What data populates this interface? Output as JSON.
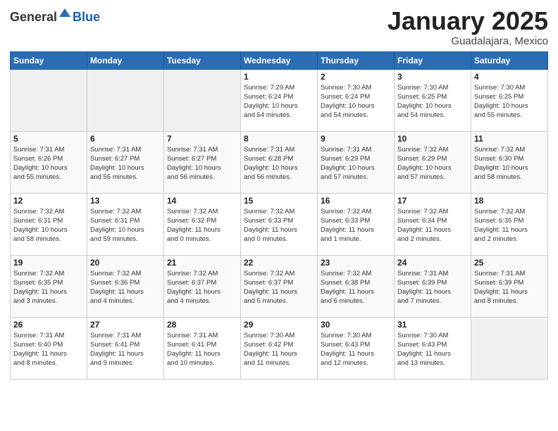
{
  "header": {
    "logo_general": "General",
    "logo_blue": "Blue",
    "month_title": "January 2025",
    "location": "Guadalajara, Mexico"
  },
  "days_of_week": [
    "Sunday",
    "Monday",
    "Tuesday",
    "Wednesday",
    "Thursday",
    "Friday",
    "Saturday"
  ],
  "weeks": [
    {
      "days": [
        {
          "num": "",
          "info": ""
        },
        {
          "num": "",
          "info": ""
        },
        {
          "num": "",
          "info": ""
        },
        {
          "num": "1",
          "info": "Sunrise: 7:29 AM\nSunset: 6:24 PM\nDaylight: 10 hours\nand 54 minutes."
        },
        {
          "num": "2",
          "info": "Sunrise: 7:30 AM\nSunset: 6:24 PM\nDaylight: 10 hours\nand 54 minutes."
        },
        {
          "num": "3",
          "info": "Sunrise: 7:30 AM\nSunset: 6:25 PM\nDaylight: 10 hours\nand 54 minutes."
        },
        {
          "num": "4",
          "info": "Sunrise: 7:30 AM\nSunset: 6:25 PM\nDaylight: 10 hours\nand 55 minutes."
        }
      ]
    },
    {
      "days": [
        {
          "num": "5",
          "info": "Sunrise: 7:31 AM\nSunset: 6:26 PM\nDaylight: 10 hours\nand 55 minutes."
        },
        {
          "num": "6",
          "info": "Sunrise: 7:31 AM\nSunset: 6:27 PM\nDaylight: 10 hours\nand 55 minutes."
        },
        {
          "num": "7",
          "info": "Sunrise: 7:31 AM\nSunset: 6:27 PM\nDaylight: 10 hours\nand 56 minutes."
        },
        {
          "num": "8",
          "info": "Sunrise: 7:31 AM\nSunset: 6:28 PM\nDaylight: 10 hours\nand 56 minutes."
        },
        {
          "num": "9",
          "info": "Sunrise: 7:31 AM\nSunset: 6:29 PM\nDaylight: 10 hours\nand 57 minutes."
        },
        {
          "num": "10",
          "info": "Sunrise: 7:32 AM\nSunset: 6:29 PM\nDaylight: 10 hours\nand 57 minutes."
        },
        {
          "num": "11",
          "info": "Sunrise: 7:32 AM\nSunset: 6:30 PM\nDaylight: 10 hours\nand 58 minutes."
        }
      ]
    },
    {
      "days": [
        {
          "num": "12",
          "info": "Sunrise: 7:32 AM\nSunset: 6:31 PM\nDaylight: 10 hours\nand 58 minutes."
        },
        {
          "num": "13",
          "info": "Sunrise: 7:32 AM\nSunset: 6:31 PM\nDaylight: 10 hours\nand 59 minutes."
        },
        {
          "num": "14",
          "info": "Sunrise: 7:32 AM\nSunset: 6:32 PM\nDaylight: 11 hours\nand 0 minutes."
        },
        {
          "num": "15",
          "info": "Sunrise: 7:32 AM\nSunset: 6:33 PM\nDaylight: 11 hours\nand 0 minutes."
        },
        {
          "num": "16",
          "info": "Sunrise: 7:32 AM\nSunset: 6:33 PM\nDaylight: 11 hours\nand 1 minute."
        },
        {
          "num": "17",
          "info": "Sunrise: 7:32 AM\nSunset: 6:34 PM\nDaylight: 11 hours\nand 2 minutes."
        },
        {
          "num": "18",
          "info": "Sunrise: 7:32 AM\nSunset: 6:35 PM\nDaylight: 11 hours\nand 2 minutes."
        }
      ]
    },
    {
      "days": [
        {
          "num": "19",
          "info": "Sunrise: 7:32 AM\nSunset: 6:35 PM\nDaylight: 11 hours\nand 3 minutes."
        },
        {
          "num": "20",
          "info": "Sunrise: 7:32 AM\nSunset: 6:36 PM\nDaylight: 11 hours\nand 4 minutes."
        },
        {
          "num": "21",
          "info": "Sunrise: 7:32 AM\nSunset: 6:37 PM\nDaylight: 11 hours\nand 4 minutes."
        },
        {
          "num": "22",
          "info": "Sunrise: 7:32 AM\nSunset: 6:37 PM\nDaylight: 11 hours\nand 5 minutes."
        },
        {
          "num": "23",
          "info": "Sunrise: 7:32 AM\nSunset: 6:38 PM\nDaylight: 11 hours\nand 6 minutes."
        },
        {
          "num": "24",
          "info": "Sunrise: 7:31 AM\nSunset: 6:39 PM\nDaylight: 11 hours\nand 7 minutes."
        },
        {
          "num": "25",
          "info": "Sunrise: 7:31 AM\nSunset: 6:39 PM\nDaylight: 11 hours\nand 8 minutes."
        }
      ]
    },
    {
      "days": [
        {
          "num": "26",
          "info": "Sunrise: 7:31 AM\nSunset: 6:40 PM\nDaylight: 11 hours\nand 8 minutes."
        },
        {
          "num": "27",
          "info": "Sunrise: 7:31 AM\nSunset: 6:41 PM\nDaylight: 11 hours\nand 9 minutes."
        },
        {
          "num": "28",
          "info": "Sunrise: 7:31 AM\nSunset: 6:41 PM\nDaylight: 11 hours\nand 10 minutes."
        },
        {
          "num": "29",
          "info": "Sunrise: 7:30 AM\nSunset: 6:42 PM\nDaylight: 11 hours\nand 11 minutes."
        },
        {
          "num": "30",
          "info": "Sunrise: 7:30 AM\nSunset: 6:43 PM\nDaylight: 11 hours\nand 12 minutes."
        },
        {
          "num": "31",
          "info": "Sunrise: 7:30 AM\nSunset: 6:43 PM\nDaylight: 11 hours\nand 13 minutes."
        },
        {
          "num": "",
          "info": ""
        }
      ]
    }
  ]
}
